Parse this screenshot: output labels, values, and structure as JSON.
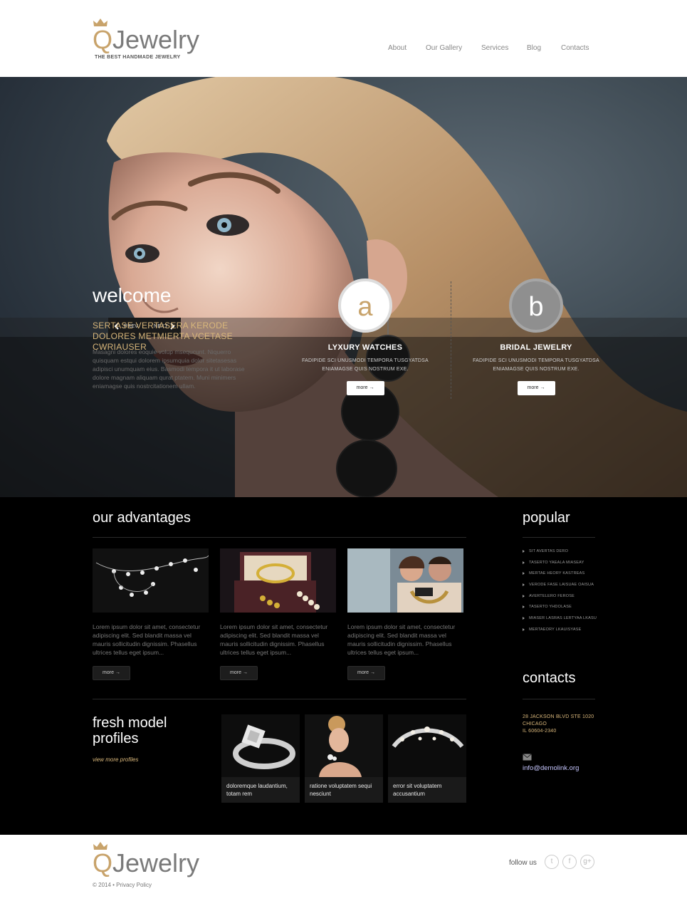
{
  "header": {
    "logo_q": "Q",
    "logo_rest": "Jewelry",
    "tagline": "THE BEST HANDMADE JEWELRY",
    "nav": [
      "About",
      "Our Gallery",
      "Services",
      "Blog",
      "Contacts"
    ]
  },
  "slider": {
    "prev": "PREV",
    "next": "NEXT"
  },
  "welcome": {
    "title": "welcome",
    "subtitle": "SERTASE VERTASERA KERODE DOLORES METMIERTA VCETASE CWRIAUSER",
    "text": "Masagni dolores eoquie volup msequcunt. Niquerro quisquam estqui dolorem ipsumquia dolor sitetasesas adipisci unumquam eius. Basmodi tempora it ut laborase dolore magnam aliquam qurat ptatem. Muni minimers eniamagse quis nostrcitationem ullam."
  },
  "features": [
    {
      "letter": "a",
      "title": "LYXURY WATCHES",
      "text": "FADIPIDE SCI UNUSMODI TEMPORA TUSGYATDSA ENIAMAGSE QUIS NOSTRUM EXE.",
      "button": "more"
    },
    {
      "letter": "b",
      "title": "BRIDAL JEWELRY",
      "text": "FADIPIDE SCI UNUSMODI TEMPORA TUSGYATDSA ENIAMAGSE QUIS NOSTRUM EXE.",
      "button": "more"
    }
  ],
  "advantages": {
    "title": "our advantages",
    "items": [
      {
        "text": "Lorem ipsum dolor sit amet, consectetur adipiscing elit. Sed blandit massa vel mauris sollicitudin dignissim. Phasellus ultrices tellus eget ipsum...",
        "button": "more"
      },
      {
        "text": "Lorem ipsum dolor sit amet, consectetur adipiscing elit. Sed blandit massa vel mauris sollicitudin dignissim. Phasellus ultrices tellus eget ipsum...",
        "button": "more"
      },
      {
        "text": "Lorem ipsum dolor sit amet, consectetur adipiscing elit. Sed blandit massa vel mauris sollicitudin dignissim. Phasellus ultrices tellus eget ipsum...",
        "button": "more"
      }
    ]
  },
  "popular": {
    "title": "popular",
    "items": [
      "SIT AVERTAS DERO",
      "TASERTO YAEALA MIASEAY",
      "MERTAE HEORY KASTREAS",
      "VERODE FASE LAISUAE OAISUA",
      "AVERTELERO FEROSE",
      "TASERTO YHDOLASE",
      "MIASER LASRAS LERTYAA LKASU",
      "MERTAEORY LKAUISYASE"
    ]
  },
  "profiles": {
    "title_line1": "fresh model",
    "title_line2": "profiles",
    "view_more": "view more profiles",
    "items": [
      {
        "caption": "doloremque laudantium, totam rem"
      },
      {
        "caption": "ratione voluptatem sequi nesciunt"
      },
      {
        "caption": "error sit voluptatem accusantium"
      }
    ]
  },
  "contacts": {
    "title": "contacts",
    "address_line1": "28 JACKSON BLVD STE 1020",
    "address_line2": "CHICAGO",
    "address_line3": "IL 60604-2340",
    "email": "info@demolink.org"
  },
  "footer": {
    "logo_q": "Q",
    "logo_rest": "Jewelry",
    "copyright": "© 2014 • Privacy Policy",
    "follow": "follow us",
    "social": [
      "twitter-icon",
      "facebook-icon",
      "google-plus-icon"
    ]
  },
  "colors": {
    "gold": "#d9b77b",
    "logo_gold": "#c8a36b",
    "dark": "#000000"
  }
}
